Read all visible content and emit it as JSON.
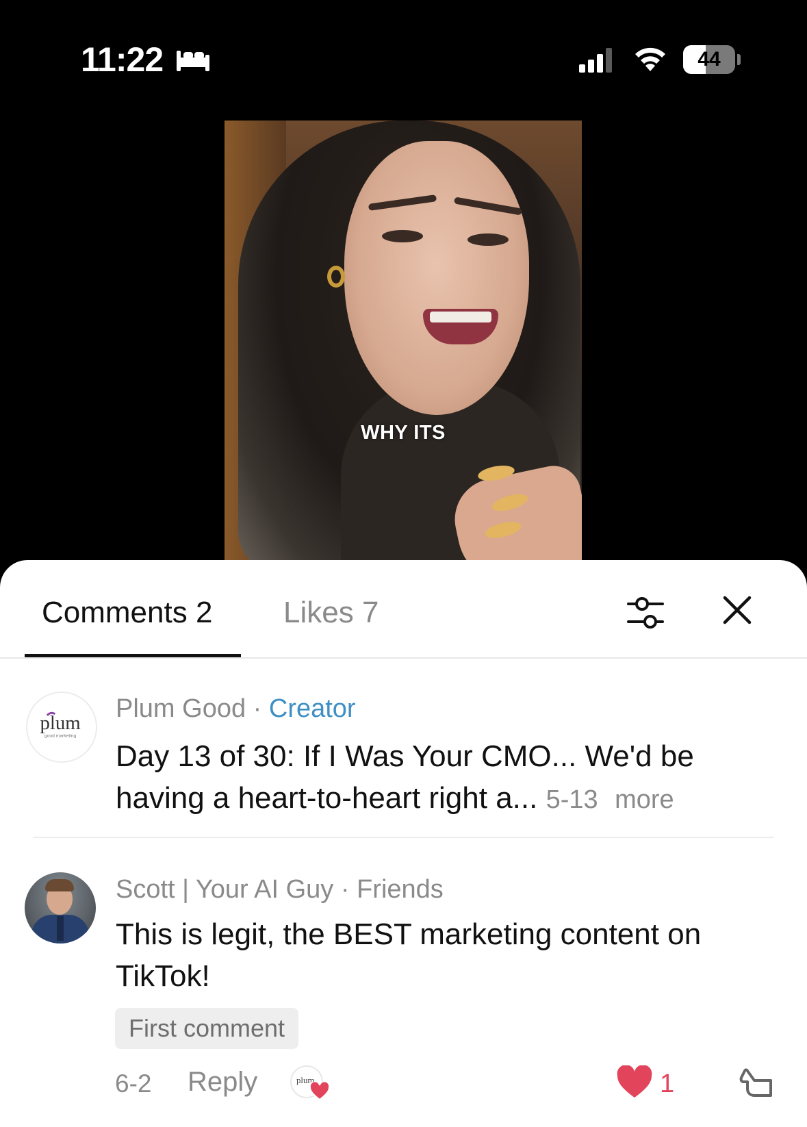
{
  "status_bar": {
    "time": "11:22",
    "battery_level": "44",
    "battery_fraction": 0.44
  },
  "video": {
    "caption": "WHY ITS"
  },
  "tabs": {
    "comments": "Comments 2",
    "likes": "Likes 7"
  },
  "comments": [
    {
      "author": "Plum Good",
      "separator": " · ",
      "tag": "Creator",
      "text": "Day 13 of 30: If I Was Your CMO... We'd be having a heart-to-heart right a... ",
      "date": "5-13",
      "more": "more",
      "avatar_logo": "plum",
      "avatar_tagline": "good marketing"
    },
    {
      "author": "Scott | Your AI Guy",
      "separator": " · ",
      "tag": "Friends",
      "text": "This is legit, the BEST marketing content on TikTok!",
      "badge": "First comment",
      "date": "6-2",
      "reply": "Reply",
      "likes": "1",
      "mini_logo": "plum"
    }
  ],
  "colors": {
    "accent_blue": "#3f8fc4",
    "heart_red": "#e2445c",
    "muted_gray": "#8a8a8a"
  },
  "icons": [
    "bed-icon",
    "cellular-signal-icon",
    "wifi-icon",
    "battery-icon",
    "filter-sliders-icon",
    "close-icon",
    "heart-icon",
    "thumbs-down-icon"
  ]
}
